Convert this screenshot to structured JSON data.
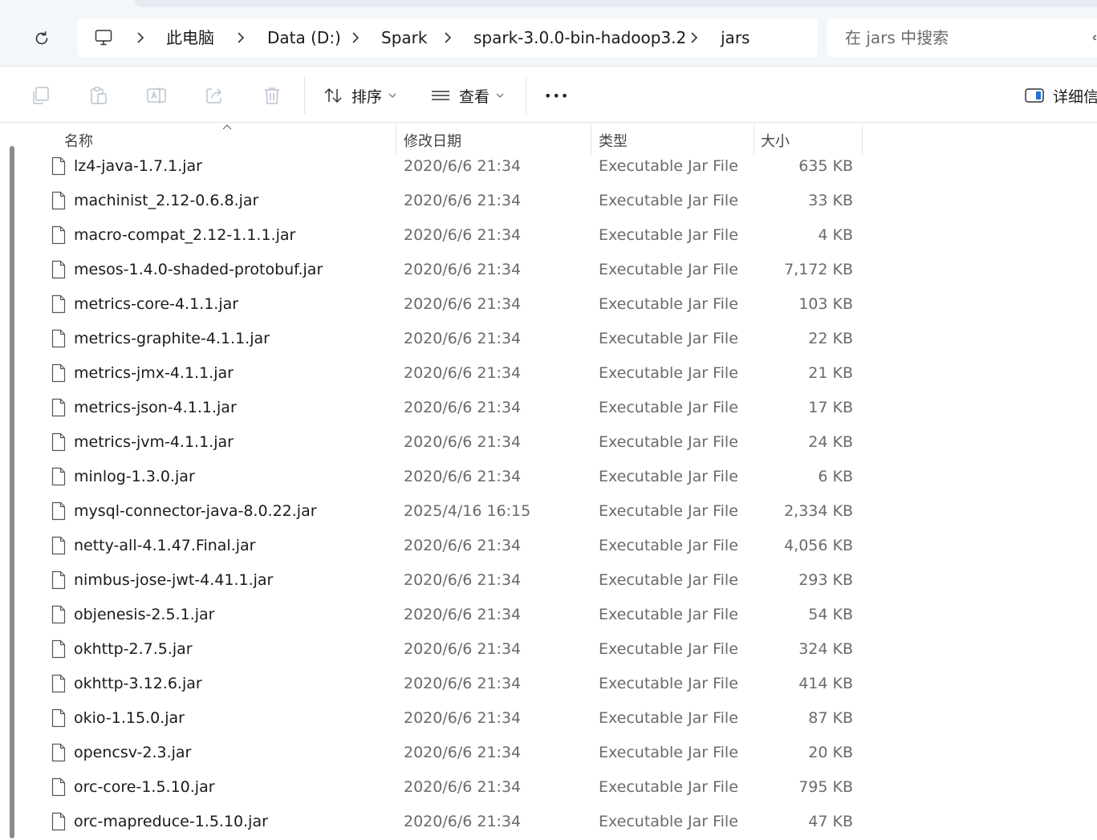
{
  "address_bar": {
    "breadcrumbs": [
      "此电脑",
      "Data (D:)",
      "Spark",
      "spark-3.0.0-bin-hadoop3.2",
      "jars"
    ],
    "search_placeholder": "在 jars 中搜索"
  },
  "toolbar": {
    "sort_label": "排序",
    "view_label": "查看",
    "more_label": "•••",
    "details_label": "详细信"
  },
  "columns": {
    "name": "名称",
    "date": "修改日期",
    "type": "类型",
    "size": "大小"
  },
  "files": [
    {
      "name": "lz4-java-1.7.1.jar",
      "date": "2020/6/6 21:34",
      "type": "Executable Jar File",
      "size": "635 KB"
    },
    {
      "name": "machinist_2.12-0.6.8.jar",
      "date": "2020/6/6 21:34",
      "type": "Executable Jar File",
      "size": "33 KB"
    },
    {
      "name": "macro-compat_2.12-1.1.1.jar",
      "date": "2020/6/6 21:34",
      "type": "Executable Jar File",
      "size": "4 KB"
    },
    {
      "name": "mesos-1.4.0-shaded-protobuf.jar",
      "date": "2020/6/6 21:34",
      "type": "Executable Jar File",
      "size": "7,172 KB"
    },
    {
      "name": "metrics-core-4.1.1.jar",
      "date": "2020/6/6 21:34",
      "type": "Executable Jar File",
      "size": "103 KB"
    },
    {
      "name": "metrics-graphite-4.1.1.jar",
      "date": "2020/6/6 21:34",
      "type": "Executable Jar File",
      "size": "22 KB"
    },
    {
      "name": "metrics-jmx-4.1.1.jar",
      "date": "2020/6/6 21:34",
      "type": "Executable Jar File",
      "size": "21 KB"
    },
    {
      "name": "metrics-json-4.1.1.jar",
      "date": "2020/6/6 21:34",
      "type": "Executable Jar File",
      "size": "17 KB"
    },
    {
      "name": "metrics-jvm-4.1.1.jar",
      "date": "2020/6/6 21:34",
      "type": "Executable Jar File",
      "size": "24 KB"
    },
    {
      "name": "minlog-1.3.0.jar",
      "date": "2020/6/6 21:34",
      "type": "Executable Jar File",
      "size": "6 KB"
    },
    {
      "name": "mysql-connector-java-8.0.22.jar",
      "date": "2025/4/16 16:15",
      "type": "Executable Jar File",
      "size": "2,334 KB"
    },
    {
      "name": "netty-all-4.1.47.Final.jar",
      "date": "2020/6/6 21:34",
      "type": "Executable Jar File",
      "size": "4,056 KB"
    },
    {
      "name": "nimbus-jose-jwt-4.41.1.jar",
      "date": "2020/6/6 21:34",
      "type": "Executable Jar File",
      "size": "293 KB"
    },
    {
      "name": "objenesis-2.5.1.jar",
      "date": "2020/6/6 21:34",
      "type": "Executable Jar File",
      "size": "54 KB"
    },
    {
      "name": "okhttp-2.7.5.jar",
      "date": "2020/6/6 21:34",
      "type": "Executable Jar File",
      "size": "324 KB"
    },
    {
      "name": "okhttp-3.12.6.jar",
      "date": "2020/6/6 21:34",
      "type": "Executable Jar File",
      "size": "414 KB"
    },
    {
      "name": "okio-1.15.0.jar",
      "date": "2020/6/6 21:34",
      "type": "Executable Jar File",
      "size": "87 KB"
    },
    {
      "name": "opencsv-2.3.jar",
      "date": "2020/6/6 21:34",
      "type": "Executable Jar File",
      "size": "20 KB"
    },
    {
      "name": "orc-core-1.5.10.jar",
      "date": "2020/6/6 21:34",
      "type": "Executable Jar File",
      "size": "795 KB"
    },
    {
      "name": "orc-mapreduce-1.5.10.jar",
      "date": "2020/6/6 21:34",
      "type": "Executable Jar File",
      "size": "47 KB"
    }
  ]
}
